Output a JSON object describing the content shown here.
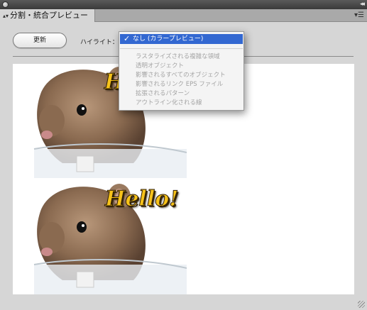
{
  "panel": {
    "tab_label": "分割・統合プレビュー",
    "update_button": "更新",
    "highlight_label": "ハイライト："
  },
  "highlight_menu": {
    "selected": "なし (カラープレビュー)",
    "items": [
      "ラスタライズされる複雑な領域",
      "透明オブジェクト",
      "影響されるすべてのオブジェクト",
      "影響されるリンク EPS ファイル",
      "拡張されるパターン",
      "アウトライン化される線"
    ]
  },
  "preview": {
    "top_text": "Hello!",
    "bottom_text": "Hello!"
  },
  "colors": {
    "selected_bg": "#3368d1",
    "hello_fill": "#f6c21a",
    "panel_bg": "#d6d6d6"
  }
}
